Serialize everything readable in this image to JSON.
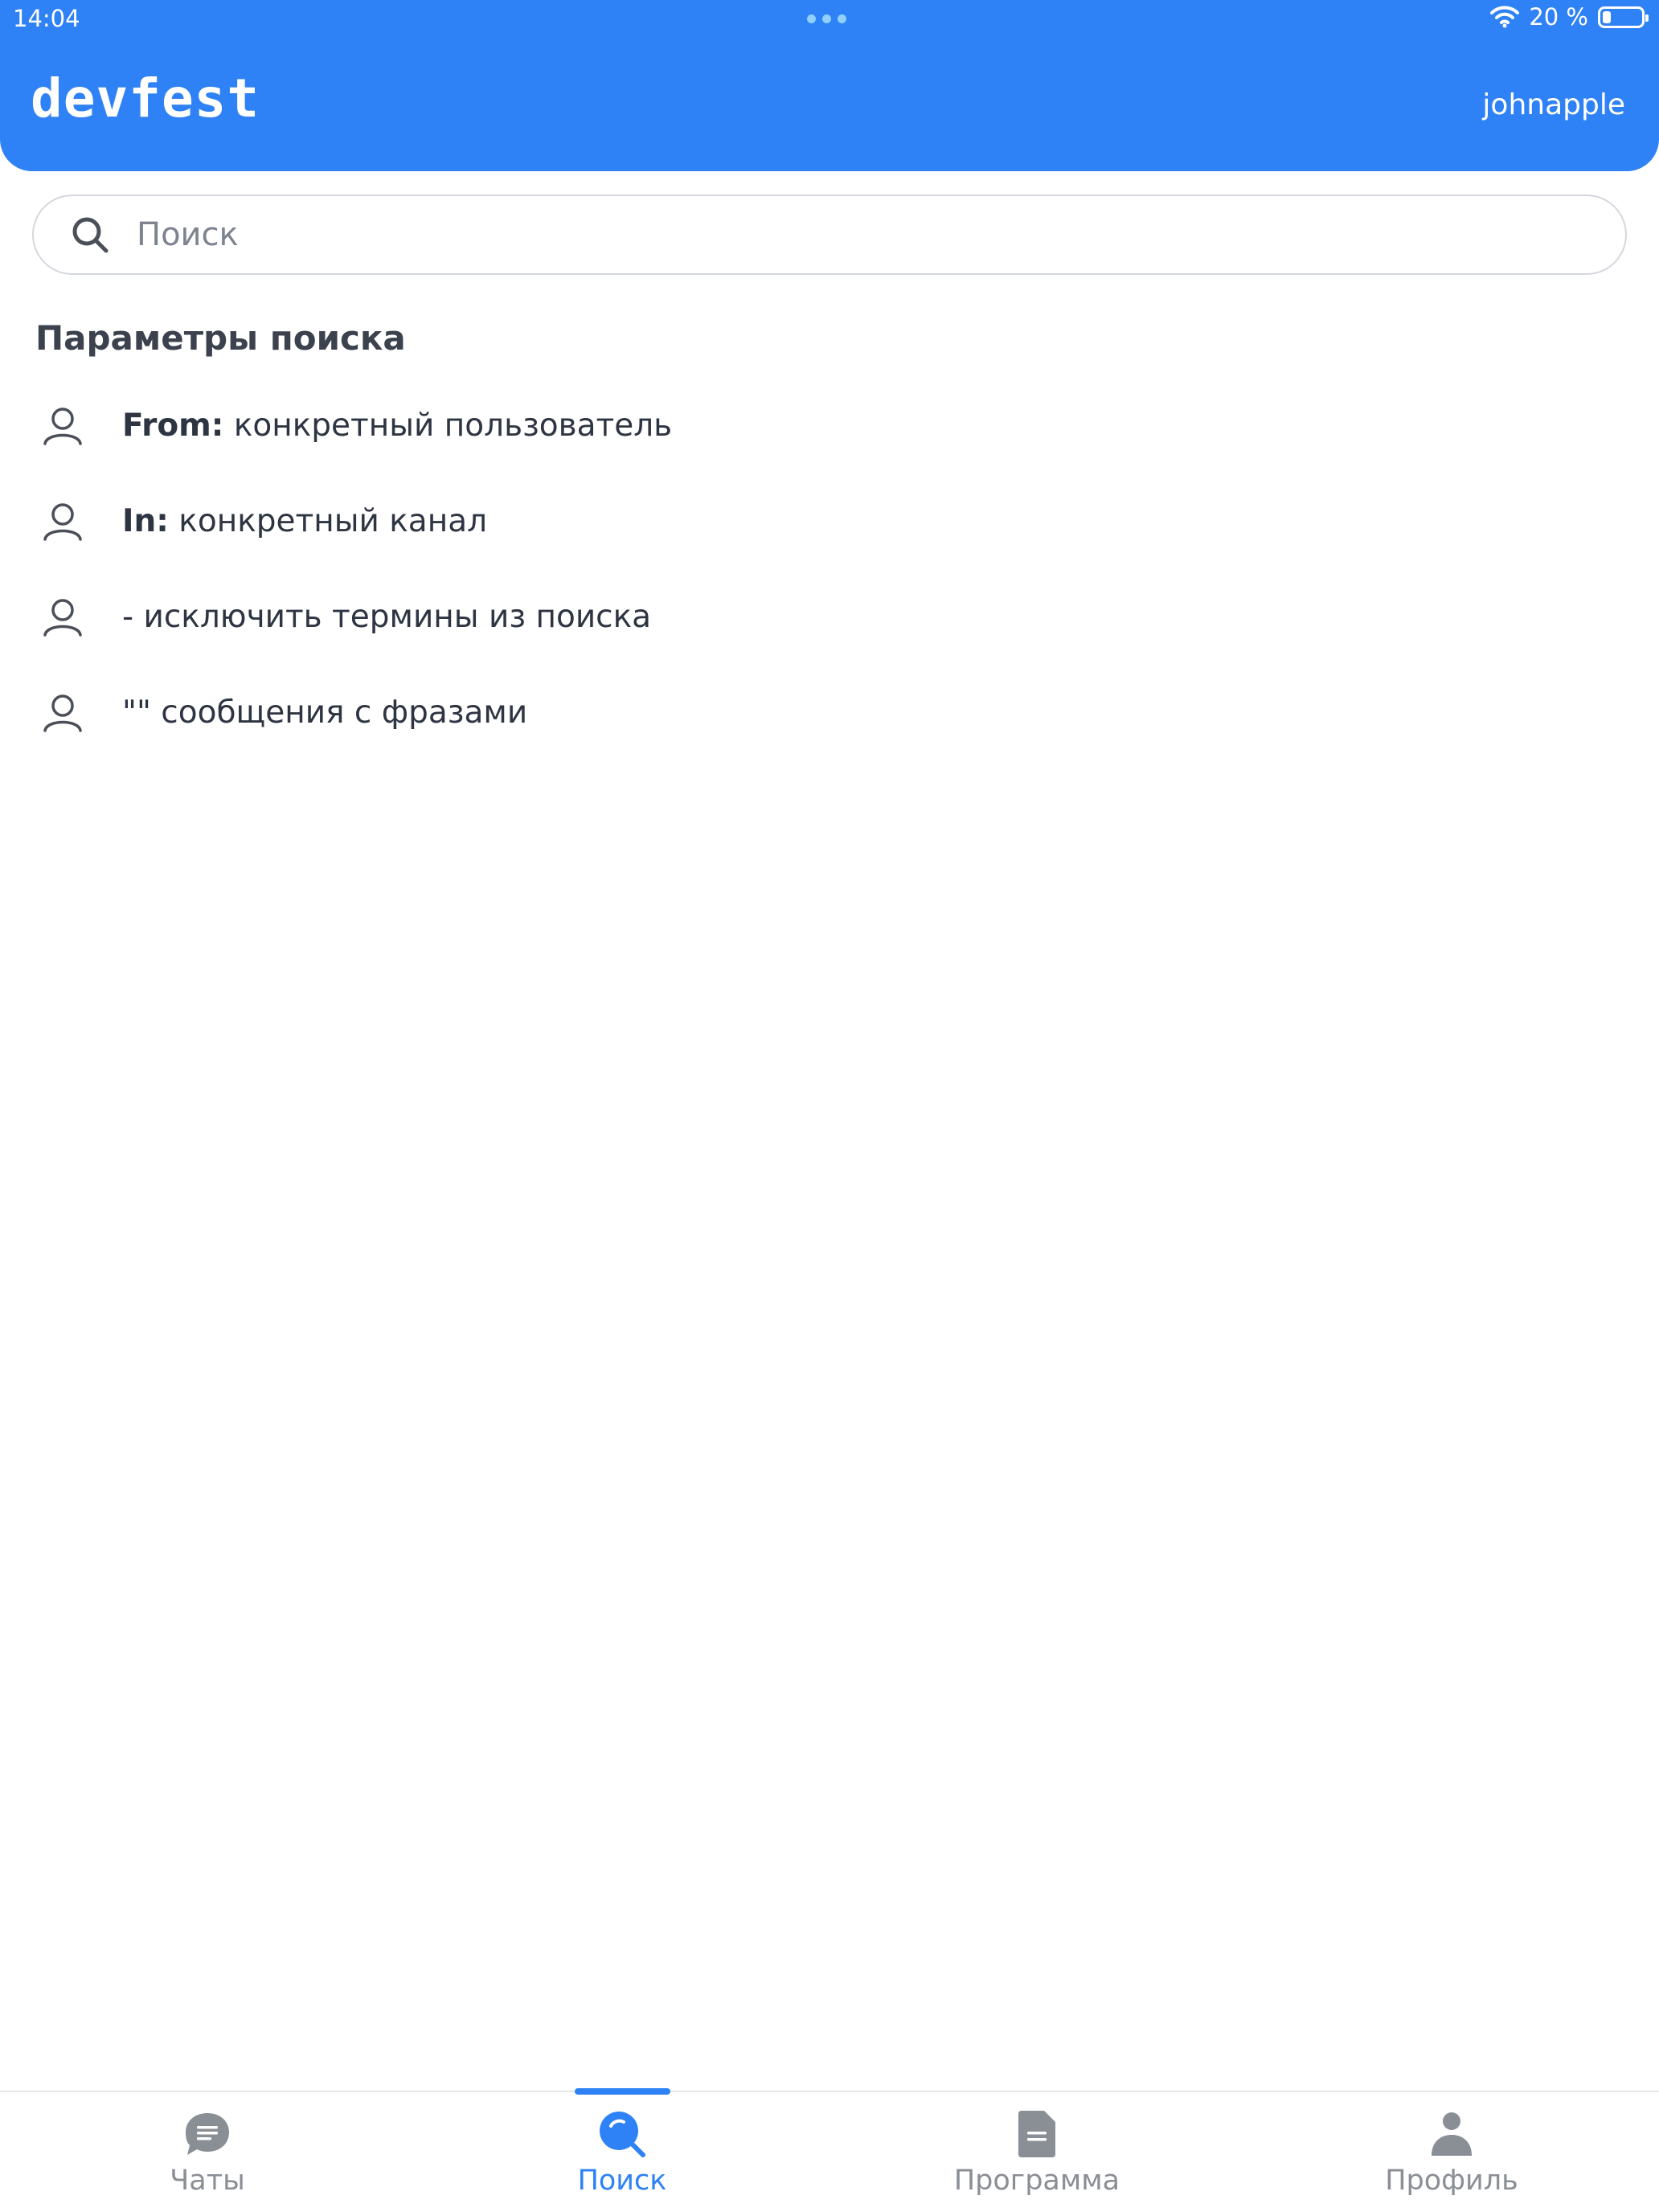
{
  "status_bar": {
    "time": "14:04",
    "battery_text": "20 %",
    "battery_level": 0.2
  },
  "header": {
    "logo": "devfest",
    "username": "johnapple"
  },
  "search": {
    "placeholder": "Поиск",
    "value": ""
  },
  "params": {
    "title": "Параметры поиска",
    "items": [
      {
        "key": "From:",
        "text": " конкретный пользователь"
      },
      {
        "key": "In:",
        "text": " конкретный канал"
      },
      {
        "key": "",
        "text": "- исключить термины из поиска"
      },
      {
        "key": "",
        "text": "\"\" сообщения с фразами"
      }
    ]
  },
  "tabbar": {
    "active_index": 1,
    "tabs": [
      {
        "label": "Чаты",
        "icon": "chat-bubble-icon"
      },
      {
        "label": "Поиск",
        "icon": "search-icon"
      },
      {
        "label": "Программа",
        "icon": "document-icon"
      },
      {
        "label": "Профиль",
        "icon": "person-icon"
      }
    ]
  },
  "colors": {
    "accent": "#2f82f6",
    "inactive": "#8a8e95"
  }
}
